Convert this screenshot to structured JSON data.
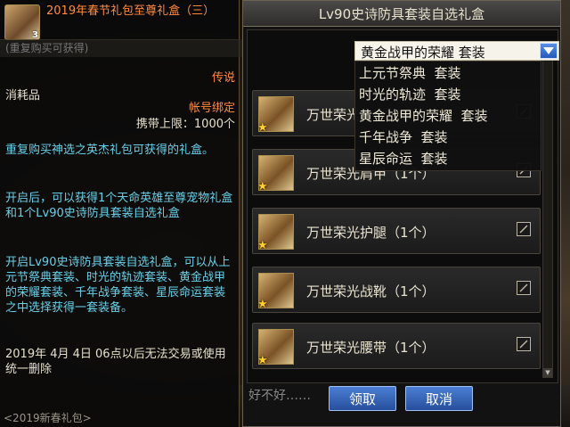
{
  "tooltip": {
    "tier": "3",
    "title": "2019年春节礼包至尊礼盒（三）",
    "subtitle": "(重复购买可获得)",
    "grade": "传说",
    "type": "消耗品",
    "bind": "帐号绑定",
    "limit": "携带上限：1000个",
    "desc1": "重复购买神选之英杰礼包可获得的礼盒。",
    "desc2": "开启后，可以获得1个天命英雄至尊宠物礼盒和1个Lv90史诗防具套装自选礼盒",
    "desc3": "开启Lv90史诗防具套装自选礼盒，可以从上元节祭典套装、时光的轨迹套装、黄金战甲的荣耀套装、千年战争套装、星辰命运套装之中选择获得一套装备。",
    "date": "2019年 4月 4日 06点以后无法交易或使用统一删除",
    "footer": "<2019新春礼包>"
  },
  "dialog": {
    "title": "Lv90史诗防具套装自选礼盒",
    "dropdown": {
      "selected": "黄金战甲的荣耀  套装",
      "options": [
        "上元节祭典  套装",
        "时光的轨迹  套装",
        "黄金战甲的荣耀  套装",
        "千年战争  套装",
        "星辰命运  套装"
      ]
    },
    "items": [
      "万世荣光上衣（1个）",
      "万世荣光肩甲（1个）",
      "万世荣光护腿（1个）",
      "万世荣光战靴（1个）",
      "万世荣光腰带（1个）"
    ],
    "input_text": "好不好……",
    "ok_label": "领取",
    "cancel_label": "取消"
  },
  "colors": {
    "title_orange": "#ff8b3d",
    "desc_cyan": "#67d0e8",
    "button_blue": "#3a6cc4"
  }
}
